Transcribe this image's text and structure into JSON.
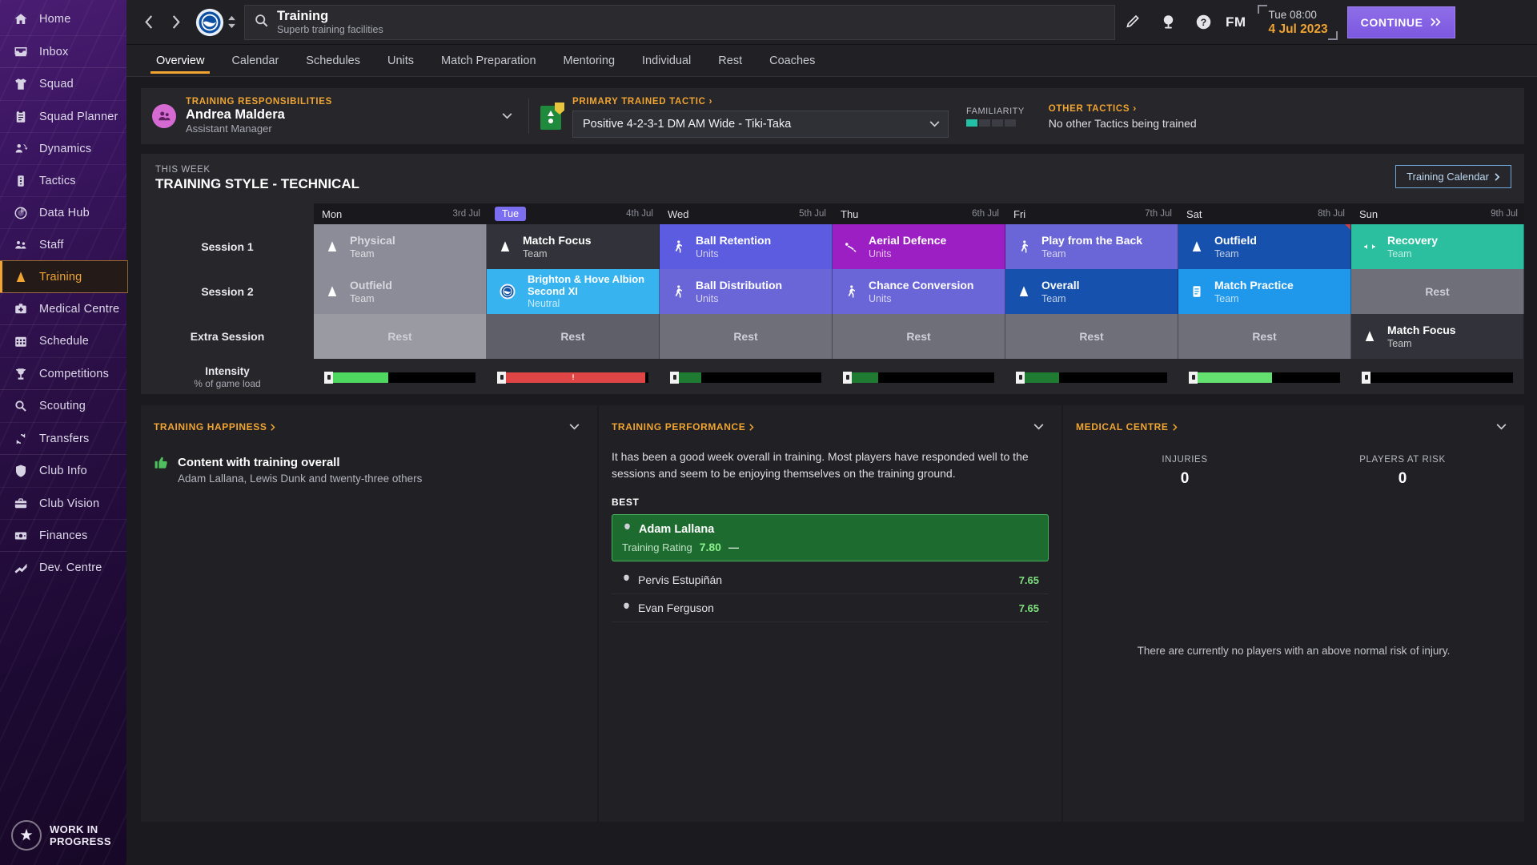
{
  "sidebar": {
    "groups": [
      {
        "items": [
          {
            "label": "Home",
            "icon": "home-icon"
          },
          {
            "label": "Inbox",
            "icon": "inbox-icon"
          }
        ]
      },
      {
        "items": [
          {
            "label": "Squad",
            "icon": "shirt-icon"
          },
          {
            "label": "Squad Planner",
            "icon": "clipboard-icon"
          },
          {
            "label": "Dynamics",
            "icon": "dynamics-icon"
          },
          {
            "label": "Tactics",
            "icon": "tactics-icon"
          },
          {
            "label": "Data Hub",
            "icon": "datahub-icon"
          },
          {
            "label": "Staff",
            "icon": "staff-icon"
          },
          {
            "label": "Training",
            "icon": "training-icon",
            "active": true
          },
          {
            "label": "Medical Centre",
            "icon": "medkit-icon"
          }
        ]
      },
      {
        "items": [
          {
            "label": "Schedule",
            "icon": "calendar-icon"
          },
          {
            "label": "Competitions",
            "icon": "trophy-icon"
          }
        ]
      },
      {
        "items": [
          {
            "label": "Scouting",
            "icon": "magnifier-icon"
          },
          {
            "label": "Transfers",
            "icon": "transfer-icon"
          }
        ]
      },
      {
        "items": [
          {
            "label": "Club Info",
            "icon": "shield-icon"
          },
          {
            "label": "Club Vision",
            "icon": "briefcase-icon"
          },
          {
            "label": "Finances",
            "icon": "money-icon"
          }
        ]
      },
      {
        "items": [
          {
            "label": "Dev. Centre",
            "icon": "growth-icon"
          }
        ]
      }
    ],
    "watermark_line1": "WORK IN",
    "watermark_line2": "PROGRESS"
  },
  "topbar": {
    "back_icon": "chevron-left-icon",
    "forward_icon": "chevron-right-icon",
    "crest_icon": "brighton-crest-icon",
    "search_title": "Training",
    "search_subtitle": "Superb training facilities",
    "search_icon": "search-icon",
    "edit_icon": "pencil-icon",
    "world_icon": "globe-icon",
    "help_icon": "help-icon",
    "fm_label": "FM",
    "date_time": "Tue 08:00",
    "date_day": "4 Jul 2023",
    "continue_label": "CONTINUE",
    "continue_icon": "double-chevron-right-icon"
  },
  "tabs": [
    {
      "label": "Overview",
      "active": true
    },
    {
      "label": "Calendar"
    },
    {
      "label": "Schedules"
    },
    {
      "label": "Units"
    },
    {
      "label": "Match Preparation"
    },
    {
      "label": "Mentoring"
    },
    {
      "label": "Individual"
    },
    {
      "label": "Rest"
    },
    {
      "label": "Coaches"
    }
  ],
  "responsibilities": {
    "caption": "TRAINING RESPONSIBILITIES",
    "name": "Andrea Maldera",
    "role": "Assistant Manager"
  },
  "primary_tactic": {
    "caption": "PRIMARY TRAINED TACTIC",
    "value": "Positive 4-2-3-1 DM AM Wide - Tiki-Taka",
    "familiarity_label": "FAMILIARITY",
    "familiarity_filled": 1,
    "familiarity_total": 4
  },
  "other_tactics": {
    "caption": "OTHER TACTICS",
    "text": "No other Tactics being trained"
  },
  "training_panel": {
    "this_week_label": "THIS WEEK",
    "style_label": "TRAINING STYLE - TECHNICAL",
    "calendar_button": "Training Calendar",
    "row_labels": [
      "Session 1",
      "Session 2",
      "Extra Session"
    ],
    "intensity_label": "Intensity",
    "intensity_sub": "% of game load",
    "days": [
      {
        "name": "Mon",
        "date": "3rd Jul",
        "today": false
      },
      {
        "name": "Tue",
        "date": "4th Jul",
        "today": true
      },
      {
        "name": "Wed",
        "date": "5th Jul",
        "today": false
      },
      {
        "name": "Thu",
        "date": "6th Jul",
        "today": false
      },
      {
        "name": "Fri",
        "date": "7th Jul",
        "today": false
      },
      {
        "name": "Sat",
        "date": "8th Jul",
        "today": false
      },
      {
        "name": "Sun",
        "date": "9th Jul",
        "today": false
      }
    ],
    "sessions": [
      [
        {
          "title": "Physical",
          "sub": "Team",
          "icon": "cone-icon",
          "bg": "#8c8c99",
          "dim": true
        },
        {
          "title": "Match Focus",
          "sub": "Team",
          "icon": "cone-icon",
          "bg": "#32323a"
        },
        {
          "title": "Ball Retention",
          "sub": "Units",
          "icon": "player-icon",
          "bg": "#5c5ce0"
        },
        {
          "title": "Aerial Defence",
          "sub": "Units",
          "icon": "header-icon",
          "bg": "#9c1fc4"
        },
        {
          "title": "Play from the Back",
          "sub": "Team",
          "icon": "player-icon",
          "bg": "#6a66d8"
        },
        {
          "title": "Outfield",
          "sub": "Team",
          "icon": "cone-icon",
          "bg": "#1652ad"
        },
        {
          "title": "Recovery",
          "sub": "Team",
          "icon": "recovery-icon",
          "bg": "#2bbfa0"
        }
      ],
      [
        {
          "title": "Outfield",
          "sub": "Team",
          "icon": "cone-icon",
          "bg": "#8c8c99",
          "dim": true
        },
        {
          "title": "Brighton & Hove Albion Second XI",
          "sub": "Neutral",
          "icon": "brighton-crest-icon",
          "bg": "#37b4f0",
          "match": true
        },
        {
          "title": "Ball Distribution",
          "sub": "Units",
          "icon": "player-icon",
          "bg": "#6a66d8"
        },
        {
          "title": "Chance Conversion",
          "sub": "Units",
          "icon": "player-icon",
          "bg": "#6a66d8"
        },
        {
          "title": "Overall",
          "sub": "Team",
          "icon": "cone-icon",
          "bg": "#1652ad"
        },
        {
          "title": "Match Practice",
          "sub": "Team",
          "icon": "note-icon",
          "bg": "#1f97ea"
        },
        {
          "title": "Rest",
          "sub": "",
          "icon": "",
          "bg": "#6f6f7a",
          "rest": true
        }
      ],
      [
        {
          "title": "Rest",
          "sub": "",
          "icon": "",
          "bg": "#9a9aa3",
          "rest": true
        },
        {
          "title": "Rest",
          "sub": "",
          "icon": "",
          "bg": "#5f5f69",
          "rest": true
        },
        {
          "title": "Rest",
          "sub": "",
          "icon": "",
          "bg": "#6f6f7a",
          "rest": true
        },
        {
          "title": "Rest",
          "sub": "",
          "icon": "",
          "bg": "#6f6f7a",
          "rest": true
        },
        {
          "title": "Rest",
          "sub": "",
          "icon": "",
          "bg": "#6f6f7a",
          "rest": true
        },
        {
          "title": "Rest",
          "sub": "",
          "icon": "",
          "bg": "#6f6f7a",
          "rest": true
        },
        {
          "title": "Match Focus",
          "sub": "Team",
          "icon": "cone-icon",
          "bg": "#32323a"
        }
      ]
    ],
    "intensity": [
      {
        "percent": 42,
        "color": "#4fd860"
      },
      {
        "percent": 98,
        "color": "#e04545",
        "warning": true
      },
      {
        "percent": 20,
        "color": "#1f7a32"
      },
      {
        "percent": 23,
        "color": "#1f7a32"
      },
      {
        "percent": 28,
        "color": "#1f7a32"
      },
      {
        "percent": 55,
        "color": "#63e06f"
      },
      {
        "percent": 4,
        "color": "#3a6fd8"
      }
    ]
  },
  "training_happiness": {
    "title": "TRAINING HAPPINESS",
    "headline": "Content with training overall",
    "detail": "Adam Lallana, Lewis Dunk and twenty-three others"
  },
  "training_performance": {
    "title": "TRAINING PERFORMANCE",
    "summary": "It has been a good week overall in training. Most players have responded well to the sessions and seem to be enjoying themselves on the training ground.",
    "best_label": "BEST",
    "best": {
      "name": "Adam Lallana",
      "rating_label": "Training Rating",
      "rating": "7.80",
      "trend": "—"
    },
    "others": [
      {
        "name": "Pervis Estupiñán",
        "rating": "7.65"
      },
      {
        "name": "Evan Ferguson",
        "rating": "7.65"
      }
    ]
  },
  "medical_centre": {
    "title": "MEDICAL CENTRE",
    "stats": [
      {
        "label": "INJURIES",
        "value": "0"
      },
      {
        "label": "PLAYERS AT RISK",
        "value": "0"
      }
    ],
    "note": "There are currently no players with an above normal risk of injury."
  }
}
